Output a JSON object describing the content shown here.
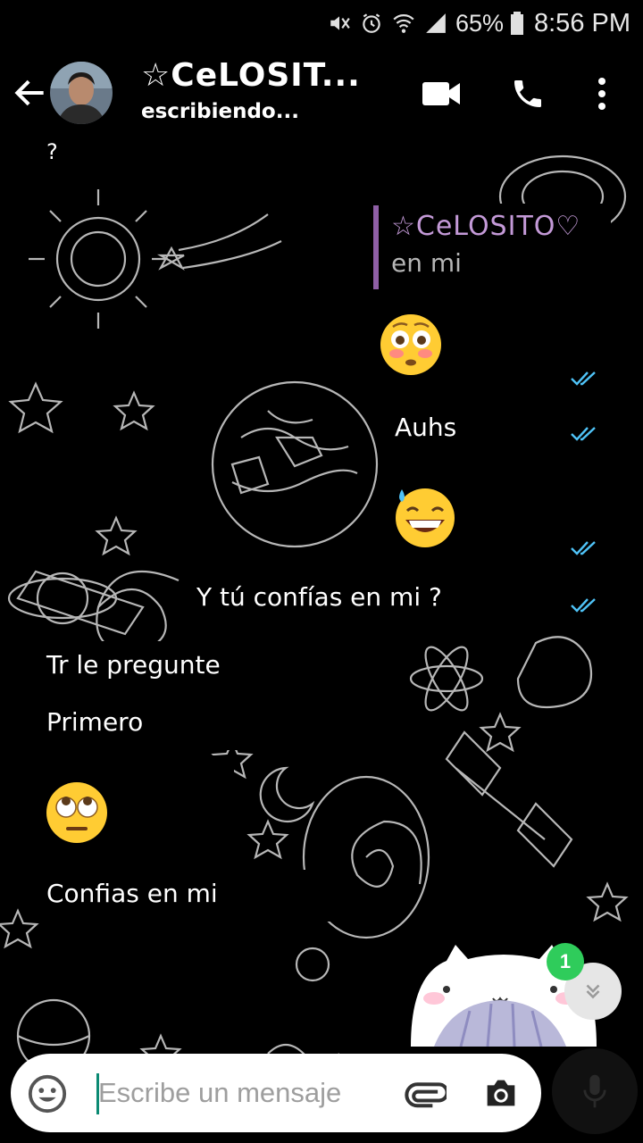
{
  "status_bar": {
    "battery_percent": "65%",
    "time": "8:56 PM"
  },
  "header": {
    "contact_name": "☆CeLOSIT...",
    "contact_status": "escribiendo..."
  },
  "messages": {
    "m0_partial": "?",
    "quoted_name": "☆CeLOSITO♡",
    "quoted_text": "en mi",
    "m_auhs": "Auhs",
    "m_confias": "Y tú confías en mi ?",
    "m_tr": "Tr le pregunte",
    "m_primero": "Primero",
    "m_confias2": "Confias en mi"
  },
  "unread_count": "1",
  "input": {
    "placeholder": "Escribe un mensaje"
  },
  "colors": {
    "quote_bar": "#8f5fa6",
    "read_ticks": "#4fc3f7",
    "unread_badge": "#2fcc5b"
  }
}
